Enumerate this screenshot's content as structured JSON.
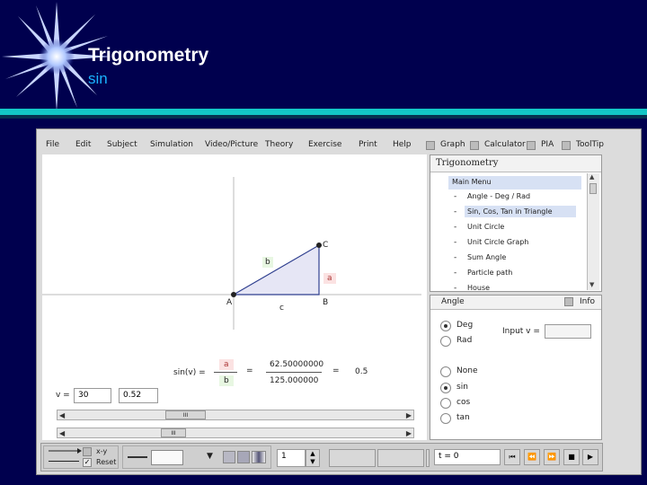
{
  "slide": {
    "title": "Trigonometry",
    "subtitle": "sin"
  },
  "menu": {
    "items": [
      "File",
      "Edit",
      "Subject",
      "Simulation",
      "Video/Picture",
      "Theory",
      "Exercise",
      "Print",
      "Help"
    ],
    "toggles": [
      "Graph",
      "Calculator",
      "PIA",
      "ToolTip"
    ]
  },
  "panel": {
    "title": "Trigonometry",
    "main_menu": "Main Menu",
    "items": [
      "Angle - Deg / Rad",
      "Sin, Cos, Tan in Triangle",
      "Unit Circle",
      "Unit Circle Graph",
      "Sum Angle",
      "Particle path",
      "House"
    ],
    "selected_item": 1,
    "dash": "-"
  },
  "angle_panel": {
    "title": "Angle",
    "info": "Info",
    "units": [
      "Deg",
      "Rad"
    ],
    "selected_unit": 0,
    "input_label": "Input v =",
    "input_value": "",
    "functions": [
      "None",
      "sin",
      "cos",
      "tan"
    ],
    "selected_function": 1
  },
  "triangle": {
    "labels": {
      "A": "A",
      "B": "B",
      "C": "C",
      "a": "a",
      "b": "b",
      "c": "c"
    }
  },
  "formula": {
    "lhs": "sin(v) =",
    "num": "a",
    "den": "b",
    "eq": "=",
    "num_value": "62.50000000",
    "den_value": "125.000000",
    "eq2": "=",
    "result": "0.5"
  },
  "inputs": {
    "v_label": "v =",
    "v_value": "30",
    "second_value": "0.52",
    "slider1_grip": "III",
    "slider2_grip": "III"
  },
  "bottom": {
    "xy_label": "x-y",
    "reset_label": "Reset",
    "step_value": "1",
    "t_label": "t = 0",
    "xy_checked": false,
    "reset_checked": true
  },
  "colors": {
    "background": "#00004e",
    "accent_bar": "#13c6c6",
    "subtitle": "#1ab3ff",
    "selection": "#d7e1f4",
    "triangle_fill": "#e6e6f5"
  }
}
